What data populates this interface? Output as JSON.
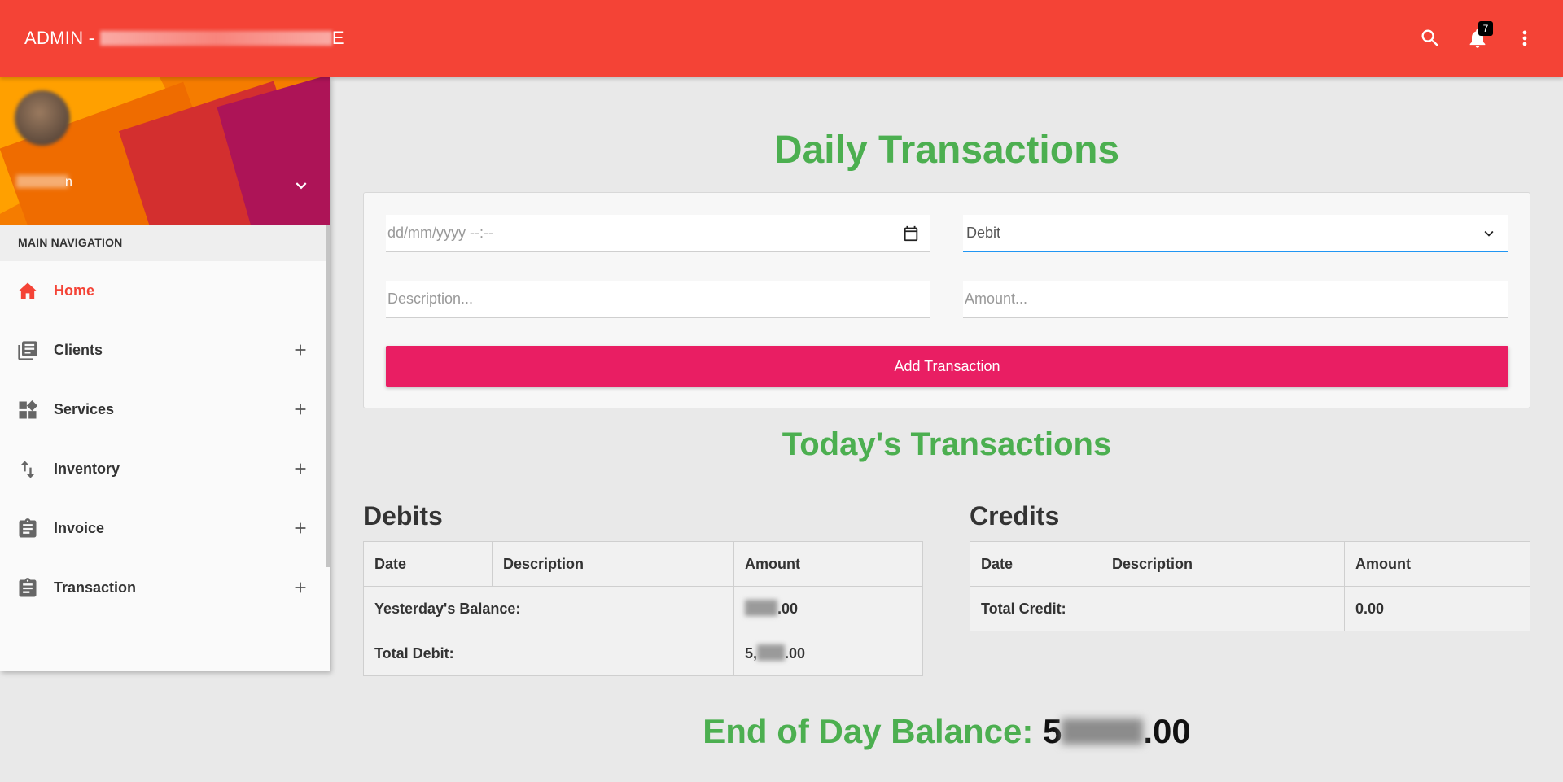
{
  "header": {
    "brand_prefix": "ADMIN - ",
    "brand_suffix": "E",
    "notification_count": "7",
    "colors": {
      "bar": "#f44336"
    }
  },
  "user": {
    "name_visible": "n"
  },
  "sidebar": {
    "nav_header": "MAIN NAVIGATION",
    "items": [
      {
        "label": "Home",
        "icon": "home-icon",
        "active": true
      },
      {
        "label": "Clients",
        "icon": "book-stack-icon"
      },
      {
        "label": "Services",
        "icon": "widgets-icon"
      },
      {
        "label": "Inventory",
        "icon": "swap-arrows-icon"
      },
      {
        "label": "Invoice",
        "icon": "clipboard-icon"
      },
      {
        "label": "Transaction",
        "icon": "clipboard-icon"
      }
    ]
  },
  "main": {
    "title": "Daily Transactions",
    "form": {
      "datetime_placeholder": "dd/mm/yyyy --:--",
      "type_value": "Debit",
      "description_placeholder": "Description...",
      "amount_placeholder": "Amount...",
      "submit_label": "Add Transaction"
    },
    "subtitle": "Today's Transactions",
    "debits": {
      "heading": "Debits",
      "columns": [
        "Date",
        "Description",
        "Amount"
      ],
      "rows": [
        {
          "label": "Yesterday's Balance:",
          "amount_visible": ".00"
        },
        {
          "label": "Total Debit:",
          "amount_prefix": "5,",
          "amount_visible": ".00"
        }
      ]
    },
    "credits": {
      "heading": "Credits",
      "columns": [
        "Date",
        "Description",
        "Amount"
      ],
      "rows": [
        {
          "label": "Total Credit:",
          "amount": "0.00"
        }
      ]
    },
    "balance": {
      "label": "End of Day Balance: ",
      "value_prefix": "5",
      "value_suffix": ".00"
    },
    "colors": {
      "accent_green": "#4caf50",
      "button_pink": "#e91e63",
      "select_blue": "#2196f3"
    }
  }
}
